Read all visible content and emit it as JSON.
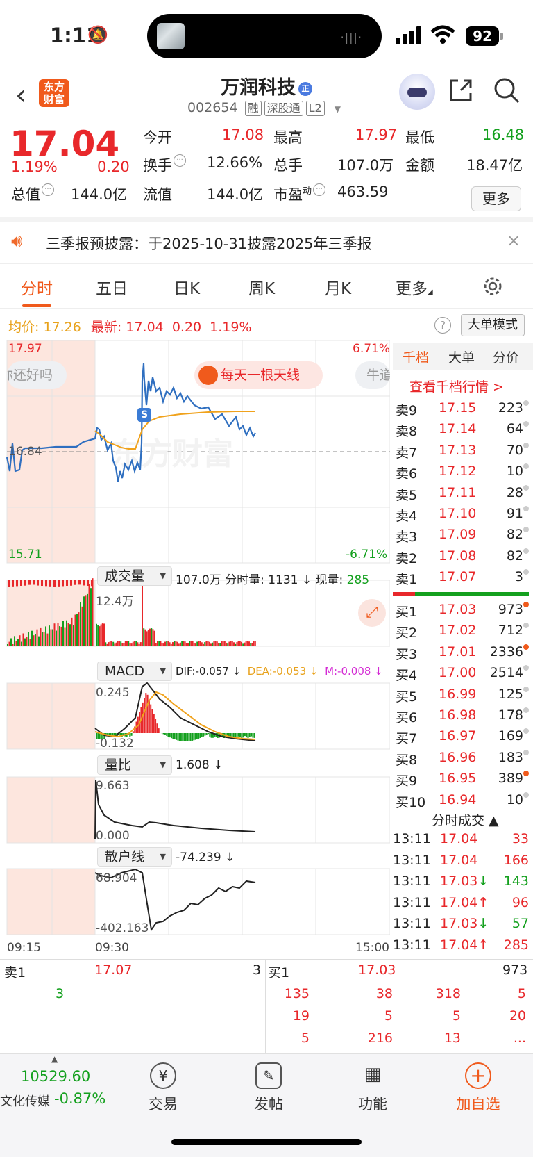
{
  "status": {
    "time": "1:11",
    "battery": "92",
    "island_wave": "·|||·"
  },
  "header": {
    "back": "‹",
    "logo_line1": "东方",
    "logo_line2": "财富",
    "title": "万润科技",
    "title_badge": "正",
    "code": "002654",
    "tags": [
      "融",
      "深股通",
      "L2"
    ]
  },
  "quote": {
    "price": "17.04",
    "change_pct": "1.19%",
    "change": "0.20",
    "open_label": "今开",
    "open": "17.08",
    "high_label": "最高",
    "high": "17.97",
    "low_label": "最低",
    "low": "16.48",
    "turnover_label": "换手",
    "turnover": "12.66%",
    "volume_label": "总手",
    "volume": "107.0万",
    "amount_label": "金额",
    "amount": "18.47亿",
    "mcap_label": "总值",
    "mcap": "144.0亿",
    "float_label": "流值",
    "float": "144.0亿",
    "pe_label": "市盈",
    "pe_sup": "动",
    "pe": "463.59",
    "more": "更多"
  },
  "notice": {
    "text": "三季报预披露：于2025-10-31披露2025年三季报",
    "close": "×"
  },
  "tabs": [
    "分时",
    "五日",
    "日K",
    "周K",
    "月K",
    "更多"
  ],
  "chart": {
    "avg_label": "均价:",
    "avg": "17.26",
    "latest_label": "最新:",
    "latest": "17.04",
    "latest_chg": "0.20",
    "latest_pct": "1.19%",
    "help": "?",
    "big_mode": "大单模式",
    "y_high": "17.97",
    "y_low": "15.71",
    "y_ref": "16.84",
    "pct_high": "6.71%",
    "pct_low": "-6.71%",
    "pill_left": "你还好吗",
    "pill_right": "牛道",
    "promo": "每天一根天线",
    "watermark": "东方财富",
    "marker": "S",
    "vol_panel": {
      "name": "成交量",
      "summary": "107.0万 分时量: 1131 ↓ 现量:",
      "now": "285",
      "max": "12.4万"
    },
    "macd_panel": {
      "name": "MACD",
      "dif": "DIF:-0.057 ↓",
      "dea": "DEA:-0.053 ↓",
      "m": "M:-0.008 ↓",
      "top": "0.245",
      "bottom": "-0.132"
    },
    "lb_panel": {
      "name": "量比",
      "value": "1.608 ↓",
      "top": "9.663",
      "bottom": "0.000"
    },
    "retail_panel": {
      "name": "散户线",
      "value": "-74.239 ↓",
      "top": "68.904",
      "bottom": "-402.163"
    },
    "times": [
      "09:15",
      "09:30",
      "15:00"
    ]
  },
  "orderbook": {
    "tabs": [
      "千档",
      "大单",
      "分价"
    ],
    "link": "查看千档行情 >",
    "asks": [
      {
        "label": "卖9",
        "price": "17.15",
        "vol": "223"
      },
      {
        "label": "卖8",
        "price": "17.14",
        "vol": "64"
      },
      {
        "label": "卖7",
        "price": "17.13",
        "vol": "70"
      },
      {
        "label": "卖6",
        "price": "17.12",
        "vol": "10"
      },
      {
        "label": "卖5",
        "price": "17.11",
        "vol": "28"
      },
      {
        "label": "卖4",
        "price": "17.10",
        "vol": "91"
      },
      {
        "label": "卖3",
        "price": "17.09",
        "vol": "82"
      },
      {
        "label": "卖2",
        "price": "17.08",
        "vol": "82"
      },
      {
        "label": "卖1",
        "price": "17.07",
        "vol": "3"
      }
    ],
    "bids": [
      {
        "label": "买1",
        "price": "17.03",
        "vol": "973"
      },
      {
        "label": "买2",
        "price": "17.02",
        "vol": "712"
      },
      {
        "label": "买3",
        "price": "17.01",
        "vol": "2336"
      },
      {
        "label": "买4",
        "price": "17.00",
        "vol": "2514"
      },
      {
        "label": "买5",
        "price": "16.99",
        "vol": "125"
      },
      {
        "label": "买6",
        "price": "16.98",
        "vol": "178"
      },
      {
        "label": "买7",
        "price": "16.97",
        "vol": "169"
      },
      {
        "label": "买8",
        "price": "16.96",
        "vol": "183"
      },
      {
        "label": "买9",
        "price": "16.95",
        "vol": "389"
      },
      {
        "label": "买10",
        "price": "16.94",
        "vol": "10"
      }
    ],
    "ticks_header": "分时成交 ▲",
    "ticks": [
      {
        "time": "13:11",
        "price": "17.04",
        "vol": "33"
      },
      {
        "time": "13:11",
        "price": "17.04",
        "vol": "166"
      },
      {
        "time": "13:11",
        "price": "17.03↓",
        "vol": "143"
      },
      {
        "time": "13:11",
        "price": "17.04↑",
        "vol": "96"
      },
      {
        "time": "13:11",
        "price": "17.03↓",
        "vol": "57"
      },
      {
        "time": "13:11",
        "price": "17.04↑",
        "vol": "285"
      }
    ]
  },
  "bottom_queue": {
    "ask_label": "卖1",
    "ask_price": "17.07",
    "ask_vol": "3",
    "bid_label": "买1",
    "bid_price": "17.03",
    "bid_vol": "973",
    "ask_queue": [
      "3"
    ],
    "bid_queue": [
      [
        "135",
        "38",
        "318",
        "5"
      ],
      [
        "19",
        "5",
        "5",
        "20"
      ],
      [
        "5",
        "216",
        "13",
        "..."
      ]
    ]
  },
  "toolbar": {
    "index_value": "10529.60",
    "index_name": "文化传媒",
    "index_chg": "-0.87%",
    "trade": "交易",
    "post": "发帖",
    "func": "功能",
    "add": "加自选"
  }
}
